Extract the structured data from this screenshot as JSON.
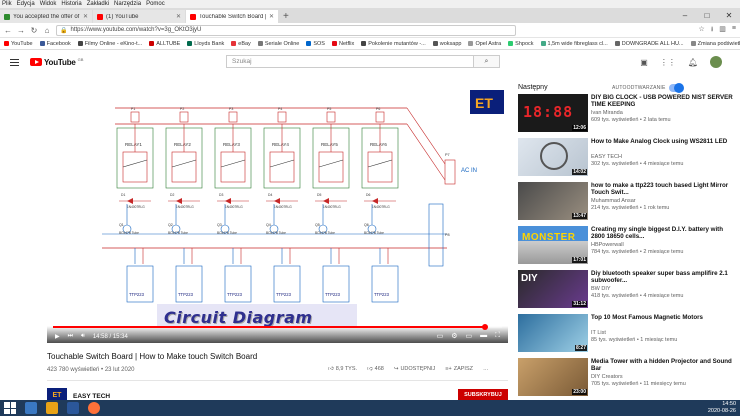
{
  "browser": {
    "menu": [
      "Plik",
      "Edycja",
      "Widok",
      "Historia",
      "Zakładki",
      "Narzędzia",
      "Pomoc"
    ],
    "tabs": [
      {
        "title": "You accepted the offer of $XXX",
        "color": "#2d8a2d",
        "active": false
      },
      {
        "title": "(1) YouTube",
        "color": "#ff0000",
        "active": false
      },
      {
        "title": "Touchable Switch Board | How t...",
        "color": "#ff0000",
        "active": true
      }
    ],
    "newtab": "+",
    "url": "https://www.youtube.com/watch?v=3g_OKtO3jyU",
    "bookmarks": [
      {
        "label": "YouTube",
        "color": "#ff0000"
      },
      {
        "label": "Facebook",
        "color": "#3b5998"
      },
      {
        "label": "Filmy Online - eKino-t...",
        "color": "#444"
      },
      {
        "label": "ALLTUBE",
        "color": "#c00"
      },
      {
        "label": "Lloyds Bank",
        "color": "#006a4d"
      },
      {
        "label": "eBay",
        "color": "#e53238"
      },
      {
        "label": "Seriale Online",
        "color": "#777"
      },
      {
        "label": "SOS",
        "color": "#0066cc"
      },
      {
        "label": "Netflix",
        "color": "#e50914"
      },
      {
        "label": "Pokolenie mutantów -...",
        "color": "#444"
      },
      {
        "label": "woksapp",
        "color": "#555"
      },
      {
        "label": "Opel Astra",
        "color": "#999"
      },
      {
        "label": "Shpock",
        "color": "#2ecc71"
      },
      {
        "label": "1,5m wide fibreglass cl...",
        "color": "#4a8"
      },
      {
        "label": "DOWNGRADE ALL HU...",
        "color": "#666"
      },
      {
        "label": "Zmiana podświetlenia...",
        "color": "#888"
      }
    ]
  },
  "youtube": {
    "logo_text": "YouTube",
    "logo_cc": "GB",
    "search_placeholder": "Szukaj",
    "video": {
      "title": "Touchable Switch Board | How to Make touch Switch Board",
      "views": "423 780 wyświetleń",
      "date": "23 lut 2020",
      "likes": "8,9 TYS.",
      "dislikes": "468",
      "share": "UDOSTĘPNIJ",
      "save": "ZAPISZ",
      "current_time": "14:58",
      "duration": "15:34",
      "progress": 0.962,
      "banner": "Circuit Diagram",
      "channel": "EASY TECH",
      "subscribe": "SUBSKRYBUJ"
    },
    "next_label": "Następny",
    "autoplay_label": "AUTOODTWARZANIE",
    "recommendations": [
      {
        "title": "DIY BIG CLOCK - USB POWERED NIST SERVER TIME KEEPING",
        "channel": "Ivan Miranda",
        "meta": "609 tys. wyświetleń • 2 lata temu",
        "duration": "12:06",
        "thumb": "clock"
      },
      {
        "title": "How to Make Analog Clock using WS2811 LED",
        "channel": "EASY TECH",
        "meta": "302 tys. wyświetleń • 4 miesiące temu",
        "duration": "14:02",
        "thumb": "analog"
      },
      {
        "title": "how to make a ttp223 touch based Light Mirror Touch Swit...",
        "channel": "Muhammad Ansar",
        "meta": "214 tys. wyświetleń • 1 rok temu",
        "duration": "13:47",
        "thumb": "mirror"
      },
      {
        "title": "Creating my single biggest D.I.Y. battery with 2800 18650 cells...",
        "channel": "HBPowerwall",
        "meta": "784 tys. wyświetleń • 2 miesiące temu",
        "duration": "17:01",
        "thumb": "battery"
      },
      {
        "title": "Diy bluetooth speaker super bass amplifire 2.1 subwoofer...",
        "channel": "BW DIY",
        "meta": "418 tys. wyświetleń • 4 miesiące temu",
        "duration": "31:12",
        "thumb": "speaker"
      },
      {
        "title": "Top 10 Most Famous Magnetic Motors",
        "channel": "IT List",
        "meta": "85 tys. wyświetleń • 1 miesiąc temu",
        "duration": "8:27",
        "thumb": "motors"
      },
      {
        "title": "Media Tower with a hidden Projector and Sound Bar",
        "channel": "DIY Creators",
        "meta": "705 tys. wyświetleń • 11 miesięcy temu",
        "duration": "23:00",
        "thumb": "tower"
      }
    ]
  },
  "schematic": {
    "relays": [
      "RELAY1",
      "RELAY2",
      "RELAY3",
      "RELAY4",
      "RELAY5",
      "RELAY6"
    ],
    "transistors": [
      "Q1",
      "Q2",
      "Q3",
      "Q4",
      "Q5",
      "Q6"
    ],
    "transistor_label": "BC547B Tube",
    "diodes": [
      "D1",
      "D2",
      "D3",
      "D4",
      "D5",
      "D6"
    ],
    "diode_label": "1N4007RLG",
    "modules": [
      "TTP223",
      "TTP223",
      "TTP223",
      "TTP223",
      "TTP223",
      "TTP223"
    ],
    "ac_label": "AC IN",
    "plug_labels": [
      "P7",
      "P8"
    ],
    "logo": "ET"
  },
  "taskbar": {
    "time": "14:50",
    "date": "2020-08-26"
  }
}
